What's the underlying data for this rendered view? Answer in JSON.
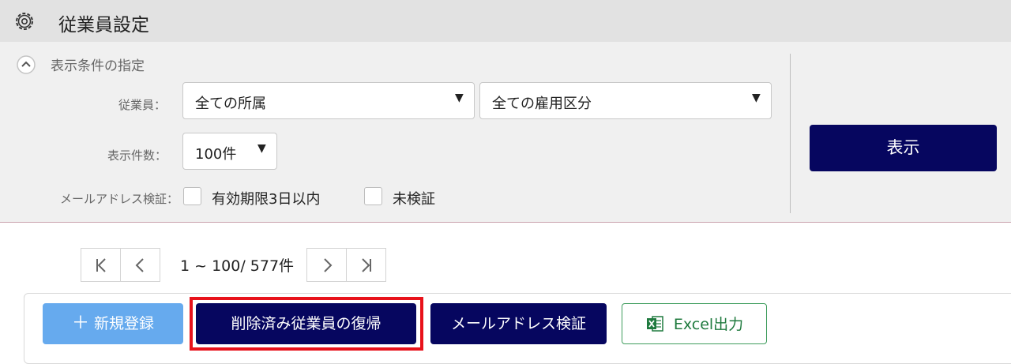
{
  "header": {
    "title": "従業員設定",
    "icon": "gear-icon"
  },
  "filter": {
    "section_title": "表示条件の指定",
    "employee_label": "従業員：",
    "department_select": "全ての所属",
    "employment_select": "全ての雇用区分",
    "count_label": "表示件数：",
    "count_select": "100件",
    "email_label": "メールアドレス検証：",
    "checkbox_expiry": "有効期限3日以内",
    "checkbox_unverified": "未検証",
    "show_button": "表示"
  },
  "pager": {
    "info": "1 ~ 100/ 577件"
  },
  "actions": {
    "new_button": "新規登録",
    "restore_button": "削除済み従業員の復帰",
    "email_button": "メールアドレス検証",
    "excel_button": "Excel出力"
  },
  "colors": {
    "navy": "#06065f",
    "light_blue": "#66aaee",
    "excel_green": "#1f7a3e",
    "highlight_red": "#e8121b"
  }
}
